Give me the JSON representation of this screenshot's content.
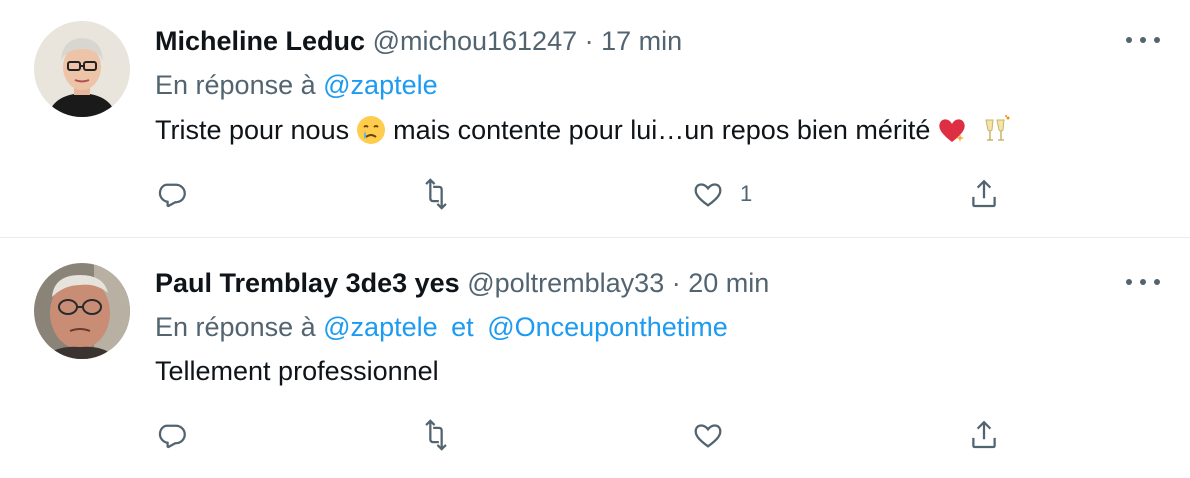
{
  "tweets": [
    {
      "name": "Micheline Leduc",
      "handle": "@michou161247",
      "separator": "·",
      "time": "17 min",
      "reply_prefix": "En réponse à",
      "mentions": [
        "@zaptele"
      ],
      "text_before": "Triste pour nous",
      "text_after": "mais contente pour lui…un repos bien mérité",
      "emojis": [
        "crying-face-emoji",
        "sparkling-heart-emoji",
        "clinking-glasses-emoji"
      ],
      "like_count": "1"
    },
    {
      "name": "Paul Tremblay 3de3 yes",
      "handle": "@poltremblay33",
      "separator": "·",
      "time": "20 min",
      "reply_prefix": "En réponse à",
      "mentions": [
        "@zaptele",
        "@Onceuponthetime"
      ],
      "mention_joiner": "et",
      "text": "Tellement professionnel"
    }
  ],
  "icons": {
    "reply": "reply-icon",
    "retweet": "retweet-icon",
    "like": "heart-icon",
    "share": "share-icon",
    "more": "more-options-icon"
  },
  "colors": {
    "text": "#0f1419",
    "secondary": "#536471",
    "link": "#1d9bf0",
    "divider": "#e6ecf0"
  }
}
